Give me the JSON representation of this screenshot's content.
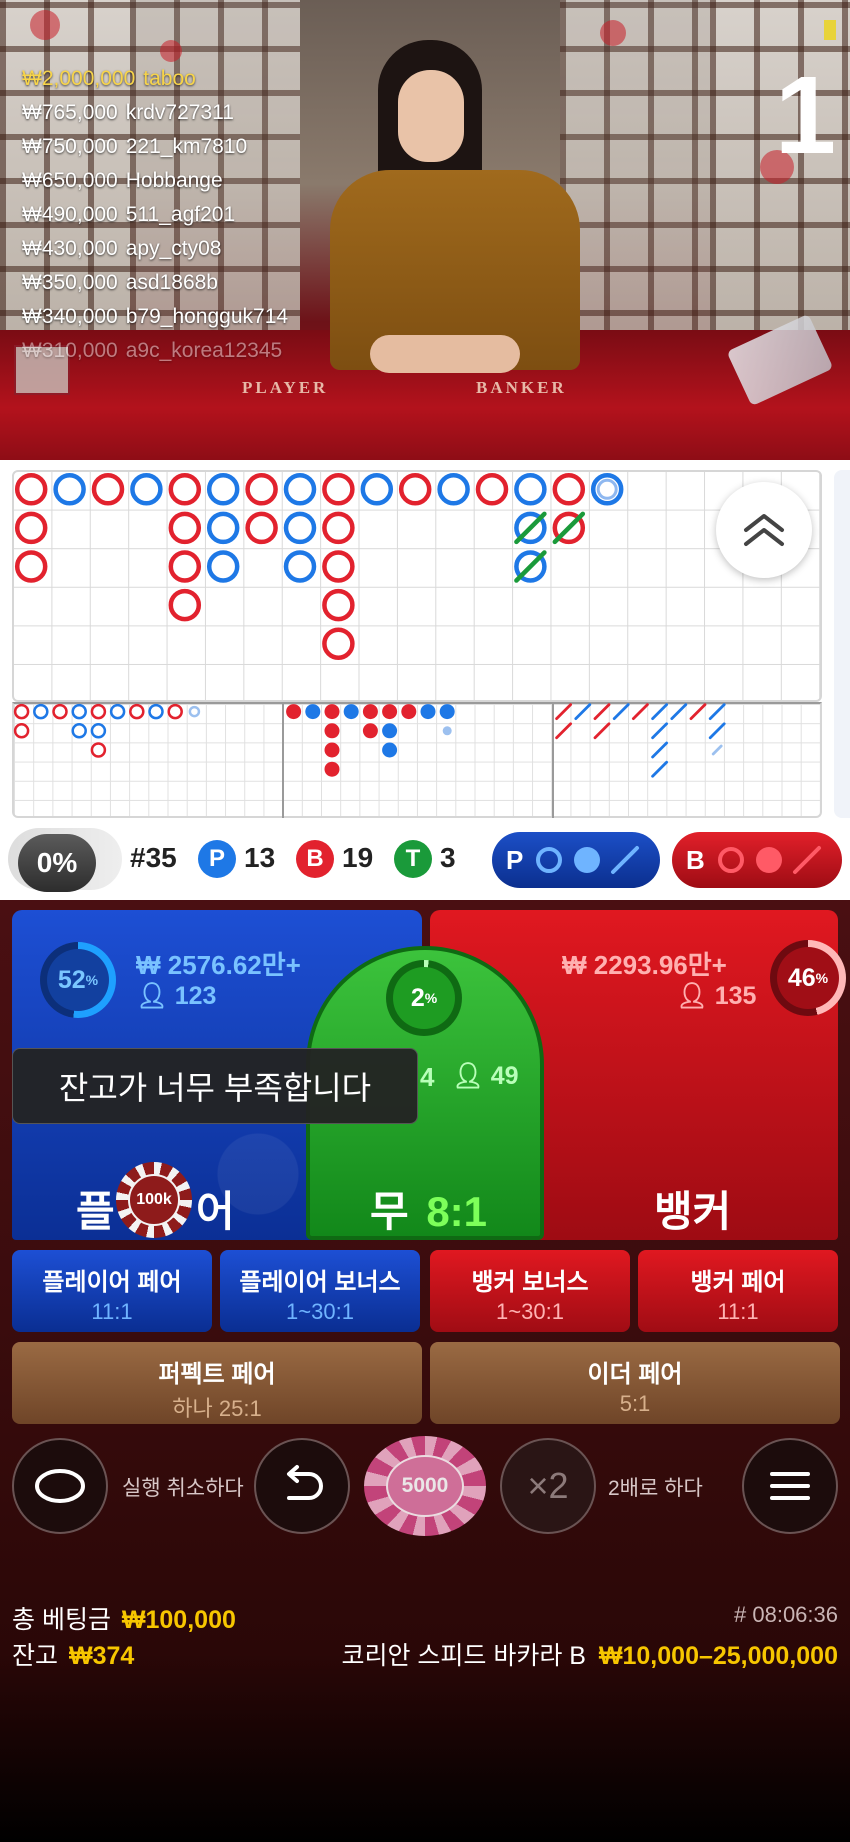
{
  "video": {
    "countdown": "1",
    "table_labels": {
      "player": "PLAYER",
      "banker": "BANKER"
    },
    "winners": [
      {
        "amount": "₩2,000,000",
        "user": "taboo",
        "style": "gold"
      },
      {
        "amount": "₩765,000",
        "user": "krdv727311",
        "style": "white"
      },
      {
        "amount": "₩750,000",
        "user": "221_km7810",
        "style": "white"
      },
      {
        "amount": "₩650,000",
        "user": "Hobbange",
        "style": "white"
      },
      {
        "amount": "₩490,000",
        "user": "511_agf201",
        "style": "white"
      },
      {
        "amount": "₩430,000",
        "user": "apy_cty08",
        "style": "white"
      },
      {
        "amount": "₩350,000",
        "user": "asd1868b",
        "style": "white"
      },
      {
        "amount": "₩340,000",
        "user": "b79_hongguk714",
        "style": "white"
      },
      {
        "amount": "₩310,000",
        "user": "a9c_korea12345",
        "style": "faded"
      }
    ]
  },
  "roadmap": {
    "bead_plate": [
      [
        "B",
        "B",
        "B"
      ],
      [
        "P"
      ],
      [
        "B"
      ],
      [
        "P"
      ],
      [
        "B",
        "B",
        "B",
        "B"
      ],
      [
        "P",
        "P",
        "P"
      ],
      [
        "B",
        "B"
      ],
      [
        "P",
        "P",
        "P"
      ],
      [
        "B",
        "B",
        "B",
        "B",
        "B"
      ],
      [
        "P"
      ],
      [
        "B"
      ],
      [
        "P"
      ],
      [
        "B"
      ],
      [
        "P",
        "P",
        "P"
      ],
      [
        "B",
        "B"
      ],
      [
        "P"
      ]
    ],
    "last_hint": "P",
    "colors": {
      "player": "#1e78e6",
      "banker": "#e2222e",
      "tie": "#1a9a3a"
    }
  },
  "stats": {
    "percent_toggle": "0%",
    "round": "#35",
    "player_letter": "P",
    "player_count": "13",
    "banker_letter": "B",
    "banker_count": "19",
    "tie_letter": "T",
    "tie_count": "3",
    "predict_player": "P",
    "predict_banker": "B"
  },
  "bets": {
    "player": {
      "percent": "52",
      "pct_sign": "%",
      "amount": "₩ 2576.62만+",
      "players": "123",
      "label_left": "플",
      "label_right": "어"
    },
    "banker": {
      "percent": "46",
      "pct_sign": "%",
      "amount": "₩ 2293.96만+",
      "players": "135",
      "label": "뱅커"
    },
    "tie": {
      "percent": "2",
      "pct_sign": "%",
      "amount_tail": "4",
      "players": "49",
      "label": "무",
      "odds": "8:1"
    },
    "placed_chip": "100k",
    "toast": "잔고가 너무 부족합니다",
    "side_bets": [
      {
        "title": "플레이어 페어",
        "odds": "11:1"
      },
      {
        "title": "플레이어 보너스",
        "odds": "1~30:1"
      },
      {
        "title": "뱅커 보너스",
        "odds": "1~30:1"
      },
      {
        "title": "뱅커 페어",
        "odds": "11:1"
      }
    ],
    "wide_bets": [
      {
        "title": "퍼펙트 페어",
        "odds": "하나 25:1"
      },
      {
        "title": "이더 페어",
        "odds": "5:1"
      }
    ]
  },
  "controls": {
    "undo_label": "실행 취소하다",
    "chip_value": "5000",
    "double_symbol": "×2",
    "double_label": "2배로 하다"
  },
  "footer": {
    "total_bet_label": "총 베팅금",
    "total_bet_value": "₩100,000",
    "balance_label": "잔고",
    "balance_value": "₩374",
    "round_id": "# 08:06:36",
    "table_name": "코리안 스피드 바카라 B",
    "limits": "₩10,000–25,000,000"
  }
}
